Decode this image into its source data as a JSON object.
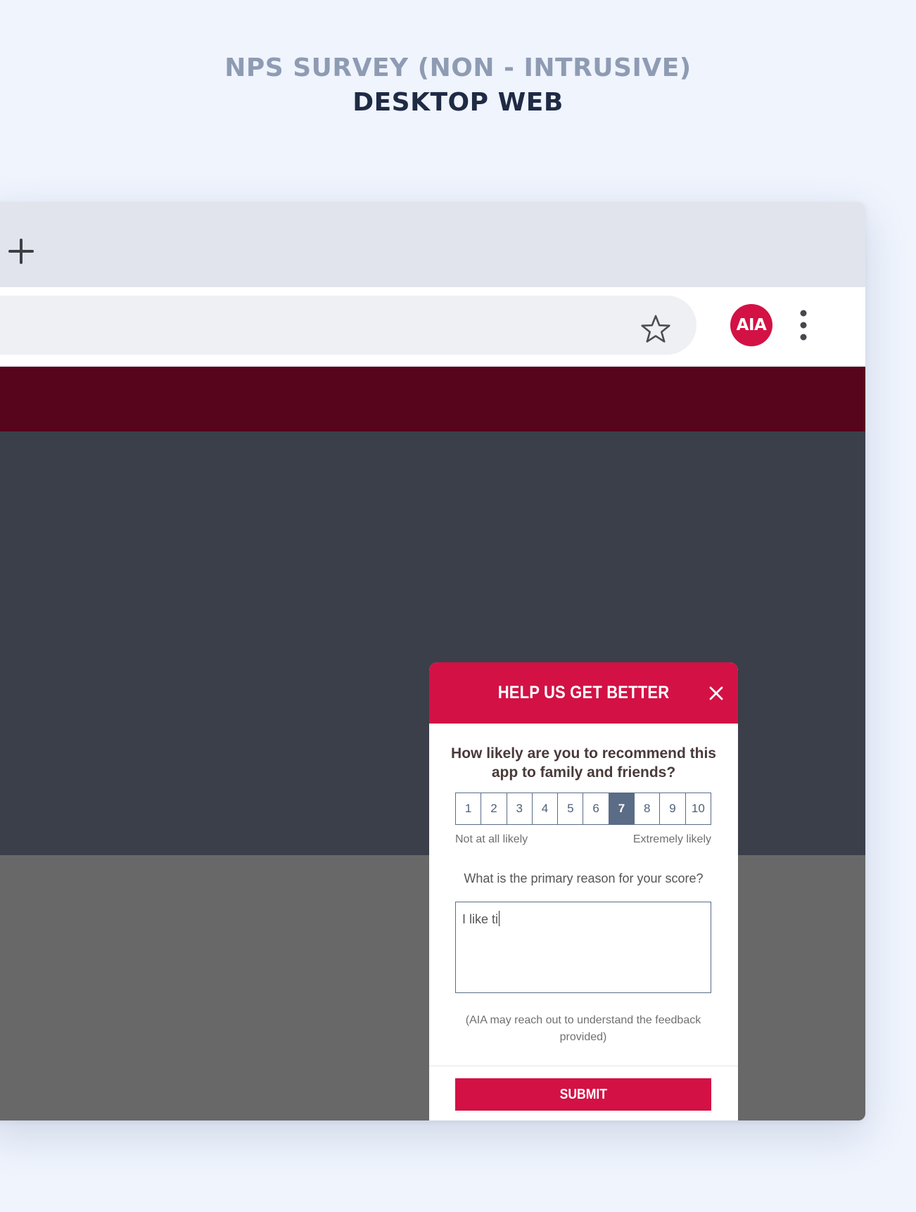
{
  "page": {
    "heading_line1": "NPS SURVEY (NON - INTRUSIVE)",
    "heading_line2": "DESKTOP WEB"
  },
  "browser": {
    "new_tab_icon": "plus-icon",
    "bookmark_icon": "star-outline-icon",
    "profile_avatar_label": "AIA",
    "menu_icon": "vertical-dots-icon"
  },
  "colors": {
    "brand_red": "#d31145",
    "site_header": "#56051c",
    "hero_bg": "#3a3f4a",
    "content_bg": "#686868",
    "scale_selected": "#5a6c86"
  },
  "survey": {
    "title": "HELP US GET BETTER",
    "close_icon": "close-icon",
    "question": "How likely are you to recommend this app to family and friends?",
    "scale": [
      "1",
      "2",
      "3",
      "4",
      "5",
      "6",
      "7",
      "8",
      "9",
      "10"
    ],
    "selected_score": "7",
    "scale_low_label": "Not at all likely",
    "scale_high_label": "Extremely likely",
    "reason_label": "What is the primary reason for your score?",
    "reason_value": "I like ti",
    "disclaimer": "(AIA may reach out to understand the feedback provided)",
    "submit_label": "SUBMIT"
  }
}
